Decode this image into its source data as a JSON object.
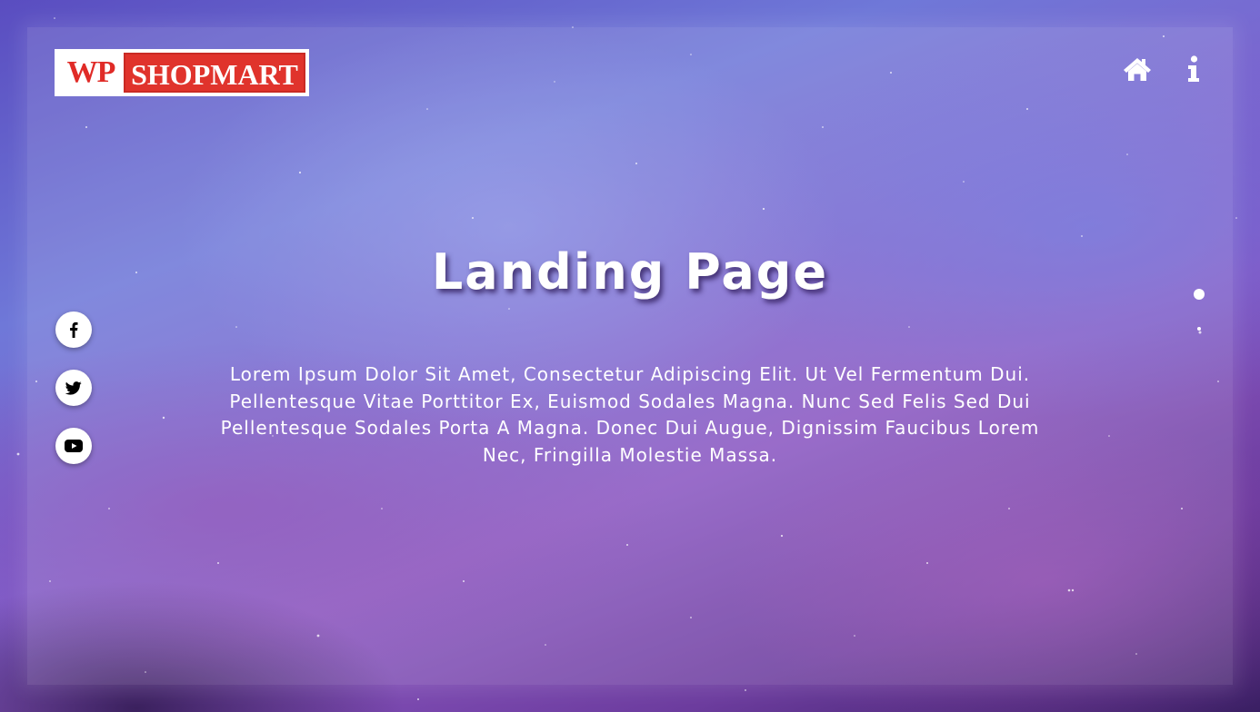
{
  "logo": {
    "part1": "WP",
    "part2": "SHOPMART",
    "brand_red": "#e0332c"
  },
  "nav_icons": [
    {
      "name": "home-icon"
    },
    {
      "name": "info-icon"
    }
  ],
  "hero": {
    "title": "Landing Page",
    "body": "Lorem Ipsum Dolor Sit Amet, Consectetur Adipiscing Elit. Ut Vel Fermentum Dui. Pellentesque Vitae Porttitor Ex, Euismod Sodales Magna. Nunc Sed Felis Sed Dui Pellentesque Sodales Porta A Magna. Donec Dui Augue, Dignissim Faucibus Lorem Nec, Fringilla Molestie Massa."
  },
  "social": [
    {
      "name": "facebook-icon"
    },
    {
      "name": "twitter-icon"
    },
    {
      "name": "youtube-icon"
    }
  ],
  "page_dots": {
    "count": 2,
    "active_index": 0
  }
}
